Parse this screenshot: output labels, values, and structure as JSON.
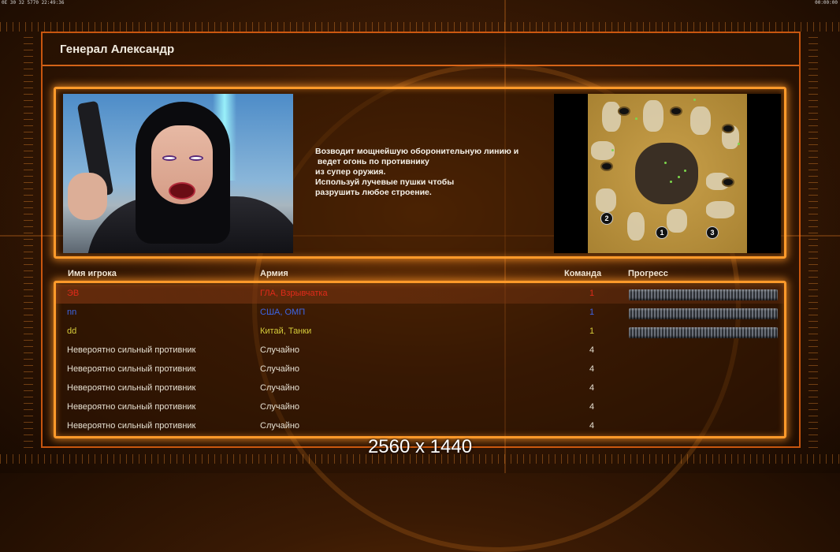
{
  "statusbar": {
    "left": "0E 30 32 5770 22:49:36",
    "right": "00:00:00"
  },
  "header": {
    "title": "Генерал Александр"
  },
  "briefing": {
    "description_lines": [
      "Возводит мощнейшую оборонительную линию и",
      " ведет огонь по противнику",
      "из супер оружия.",
      "Используй лучевые пушки чтобы",
      "разрушить любое строение."
    ],
    "minimap": {
      "start_positions": [
        "1",
        "2",
        "3"
      ]
    }
  },
  "table": {
    "columns": {
      "player": "Имя игрока",
      "army": "Армия",
      "team": "Команда",
      "progress": "Прогресс"
    },
    "rows": [
      {
        "name": "ЭВ",
        "army": "ГЛА, Взрывчатка",
        "team": "1",
        "color": "#e02a1a",
        "progress": 1,
        "selected": true
      },
      {
        "name": "nn",
        "army": "США, ОМП",
        "team": "1",
        "color": "#3d66e6",
        "progress": 1,
        "selected": false
      },
      {
        "name": "dd",
        "army": "Китай, Танки",
        "team": "1",
        "color": "#d6cc3a",
        "progress": 1,
        "selected": false
      },
      {
        "name": "Невероятно сильный противник",
        "army": "Случайно",
        "team": "4",
        "color": "#e6e0d2",
        "progress": null,
        "selected": false
      },
      {
        "name": "Невероятно сильный противник",
        "army": "Случайно",
        "team": "4",
        "color": "#e6e0d2",
        "progress": null,
        "selected": false
      },
      {
        "name": "Невероятно сильный противник",
        "army": "Случайно",
        "team": "4",
        "color": "#e6e0d2",
        "progress": null,
        "selected": false
      },
      {
        "name": "Невероятно сильный противник",
        "army": "Случайно",
        "team": "4",
        "color": "#e6e0d2",
        "progress": null,
        "selected": false
      },
      {
        "name": "Невероятно сильный противник",
        "army": "Случайно",
        "team": "4",
        "color": "#e6e0d2",
        "progress": null,
        "selected": false
      }
    ]
  },
  "overlay": {
    "resolution_text": "2560 x 1440"
  }
}
